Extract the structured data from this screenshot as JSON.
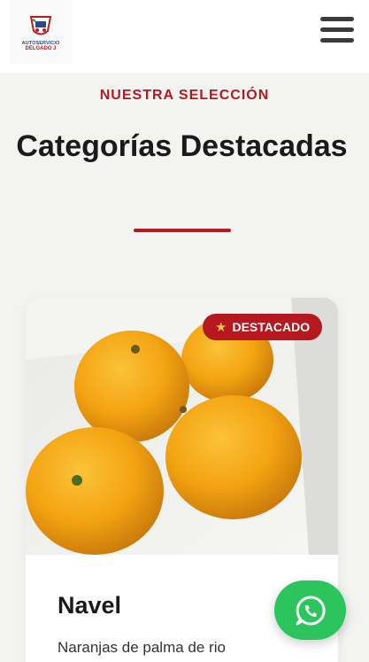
{
  "header": {
    "logo_line1": "AUTOSERVICIO",
    "logo_line2": "DELGADO J",
    "menu_icon": "hamburger-menu-icon"
  },
  "section": {
    "kicker": "NUESTRA SELECCIÓN",
    "title": "Categorías Destacadas"
  },
  "featured_card": {
    "badge": "DESTACADO",
    "badge_icon": "star-icon",
    "title": "Navel",
    "description": "Naranjas de palma de rio",
    "image": "oranges-photo"
  },
  "whatsapp": {
    "icon": "whatsapp-icon",
    "color": "#2cc45c"
  },
  "colors": {
    "accent": "#b5191f",
    "background": "#f3f3f1"
  }
}
